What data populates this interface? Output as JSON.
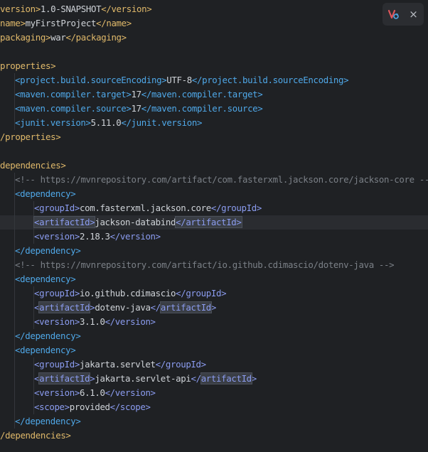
{
  "toolbar": {
    "maven_icon": "maven-reload-icon",
    "close_label": "×"
  },
  "lines": [
    {
      "parts": [
        {
          "c": "tag yellow",
          "t": "version>"
        },
        {
          "c": "text",
          "t": "1.0-SNAPSHOT"
        },
        {
          "c": "tag yellow",
          "t": "</version>"
        }
      ]
    },
    {
      "parts": [
        {
          "c": "tag yellow",
          "t": "name>"
        },
        {
          "c": "text",
          "t": "myFirstProject"
        },
        {
          "c": "tag yellow",
          "t": "</name>"
        }
      ]
    },
    {
      "parts": [
        {
          "c": "tag yellow",
          "t": "packaging>"
        },
        {
          "c": "text",
          "t": "war"
        },
        {
          "c": "tag yellow",
          "t": "</packaging>"
        }
      ]
    },
    {
      "parts": []
    },
    {
      "parts": [
        {
          "c": "tag yellow",
          "t": "properties>"
        }
      ]
    },
    {
      "indent": 1,
      "parts": [
        {
          "c": "tag blue",
          "t": "<project.build.sourceEncoding>"
        },
        {
          "c": "text",
          "t": "UTF-8"
        },
        {
          "c": "tag blue",
          "t": "</project.build.sourceEncoding>"
        }
      ]
    },
    {
      "indent": 1,
      "parts": [
        {
          "c": "tag blue",
          "t": "<maven.compiler.target>"
        },
        {
          "c": "text",
          "t": "17"
        },
        {
          "c": "tag blue",
          "t": "</maven.compiler.target>"
        }
      ]
    },
    {
      "indent": 1,
      "parts": [
        {
          "c": "tag blue",
          "t": "<maven.compiler.source>"
        },
        {
          "c": "text",
          "t": "17"
        },
        {
          "c": "tag blue",
          "t": "</maven.compiler.source>"
        }
      ]
    },
    {
      "indent": 1,
      "parts": [
        {
          "c": "tag blue",
          "t": "<junit.version>"
        },
        {
          "c": "text",
          "t": "5.11.0"
        },
        {
          "c": "tag blue",
          "t": "</junit.version>"
        }
      ]
    },
    {
      "parts": [
        {
          "c": "tag yellow",
          "t": "/properties>"
        }
      ]
    },
    {
      "parts": []
    },
    {
      "parts": [
        {
          "c": "tag yellow",
          "t": "dependencies>"
        }
      ]
    },
    {
      "indent": 1,
      "parts": [
        {
          "c": "comment",
          "t": "<!-- "
        },
        {
          "c": "comment link",
          "t": "https://mvnrepository.com/artifact/com.fasterxml.jackson.core/jackson-core"
        },
        {
          "c": "comment",
          "t": " -->"
        }
      ]
    },
    {
      "indent": 1,
      "parts": [
        {
          "c": "tag blue",
          "t": "<dependency>"
        }
      ]
    },
    {
      "indent": 2,
      "parts": [
        {
          "c": "tag purple",
          "t": "<groupId>"
        },
        {
          "c": "text",
          "t": "com.fasterxml.jackson.core"
        },
        {
          "c": "tag purple",
          "t": "</groupId>"
        }
      ]
    },
    {
      "indent": 2,
      "highlight": true,
      "parts": [
        {
          "c": "tag purple match",
          "t": "<artifactId>"
        },
        {
          "c": "text",
          "t": "jackson-databind"
        },
        {
          "c": "tag purple match",
          "t": "</artifactId>"
        }
      ]
    },
    {
      "indent": 2,
      "parts": [
        {
          "c": "tag purple",
          "t": "<version>"
        },
        {
          "c": "text",
          "t": "2.18.3"
        },
        {
          "c": "tag purple",
          "t": "</version>"
        }
      ]
    },
    {
      "indent": 1,
      "parts": [
        {
          "c": "tag blue",
          "t": "</dependency>"
        }
      ]
    },
    {
      "indent": 1,
      "parts": [
        {
          "c": "comment",
          "t": "<!-- "
        },
        {
          "c": "comment link",
          "t": "https://mvnrepository.com/artifact/io.github.cdimascio/dotenv-java"
        },
        {
          "c": "comment",
          "t": " -->"
        }
      ]
    },
    {
      "indent": 1,
      "parts": [
        {
          "c": "tag blue",
          "t": "<dependency>"
        }
      ]
    },
    {
      "indent": 2,
      "parts": [
        {
          "c": "tag purple",
          "t": "<groupId>"
        },
        {
          "c": "text",
          "t": "io.github.cdimascio"
        },
        {
          "c": "tag purple",
          "t": "</groupId>"
        }
      ]
    },
    {
      "indent": 2,
      "parts": [
        {
          "c": "tag purple",
          "t": "<"
        },
        {
          "c": "tag purple match",
          "t": "artifactId"
        },
        {
          "c": "tag purple",
          "t": ">"
        },
        {
          "c": "text",
          "t": "dotenv-java"
        },
        {
          "c": "tag purple",
          "t": "</"
        },
        {
          "c": "tag purple match",
          "t": "artifactId"
        },
        {
          "c": "tag purple",
          "t": ">"
        }
      ]
    },
    {
      "indent": 2,
      "parts": [
        {
          "c": "tag purple",
          "t": "<version>"
        },
        {
          "c": "text",
          "t": "3.1.0"
        },
        {
          "c": "tag purple",
          "t": "</version>"
        }
      ]
    },
    {
      "indent": 1,
      "parts": [
        {
          "c": "tag blue",
          "t": "</dependency>"
        }
      ]
    },
    {
      "indent": 1,
      "parts": [
        {
          "c": "tag blue",
          "t": "<dependency>"
        }
      ]
    },
    {
      "indent": 2,
      "parts": [
        {
          "c": "tag purple",
          "t": "<groupId>"
        },
        {
          "c": "text",
          "t": "jakarta.servlet"
        },
        {
          "c": "tag purple",
          "t": "</groupId>"
        }
      ]
    },
    {
      "indent": 2,
      "parts": [
        {
          "c": "tag purple",
          "t": "<"
        },
        {
          "c": "tag purple match",
          "t": "artifactId"
        },
        {
          "c": "tag purple",
          "t": ">"
        },
        {
          "c": "text",
          "t": "jakarta.servlet-api"
        },
        {
          "c": "tag purple",
          "t": "</"
        },
        {
          "c": "tag purple match",
          "t": "artifactId"
        },
        {
          "c": "tag purple",
          "t": ">"
        }
      ]
    },
    {
      "indent": 2,
      "parts": [
        {
          "c": "tag purple",
          "t": "<version>"
        },
        {
          "c": "text",
          "t": "6.1.0"
        },
        {
          "c": "tag purple",
          "t": "</version>"
        }
      ]
    },
    {
      "indent": 2,
      "parts": [
        {
          "c": "tag purple",
          "t": "<scope>"
        },
        {
          "c": "text",
          "t": "provided"
        },
        {
          "c": "tag purple",
          "t": "</scope>"
        }
      ]
    },
    {
      "indent": 1,
      "parts": [
        {
          "c": "tag blue",
          "t": "</dependency>"
        }
      ]
    },
    {
      "parts": [
        {
          "c": "tag yellow",
          "t": "/dependencies>"
        }
      ]
    }
  ]
}
